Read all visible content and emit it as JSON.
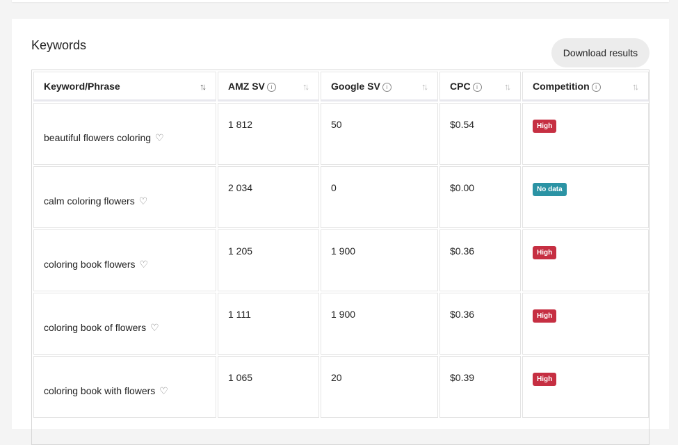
{
  "section": {
    "title": "Keywords",
    "download_label": "Download results"
  },
  "columns": [
    {
      "label": "Keyword/Phrase",
      "info": false
    },
    {
      "label": "AMZ SV",
      "info": true
    },
    {
      "label": "Google SV",
      "info": true
    },
    {
      "label": "CPC",
      "info": true
    },
    {
      "label": "Competition",
      "info": true
    }
  ],
  "sort_glyph": "↑↓",
  "info_glyph": "i",
  "heart_glyph": "♡",
  "colors": {
    "high": "#c62f42",
    "no_data": "#2b93a4"
  },
  "rows": [
    {
      "keyword": "beautiful flowers coloring",
      "amz_sv": "1 812",
      "google_sv": "50",
      "cpc": "$0.54",
      "competition": "High"
    },
    {
      "keyword": "calm coloring flowers",
      "amz_sv": "2 034",
      "google_sv": "0",
      "cpc": "$0.00",
      "competition": "No data"
    },
    {
      "keyword": "coloring book flowers",
      "amz_sv": "1 205",
      "google_sv": "1 900",
      "cpc": "$0.36",
      "competition": "High"
    },
    {
      "keyword": "coloring book of flowers",
      "amz_sv": "1 111",
      "google_sv": "1 900",
      "cpc": "$0.36",
      "competition": "High"
    },
    {
      "keyword": "coloring book with flowers",
      "amz_sv": "1 065",
      "google_sv": "20",
      "cpc": "$0.39",
      "competition": "High"
    }
  ]
}
